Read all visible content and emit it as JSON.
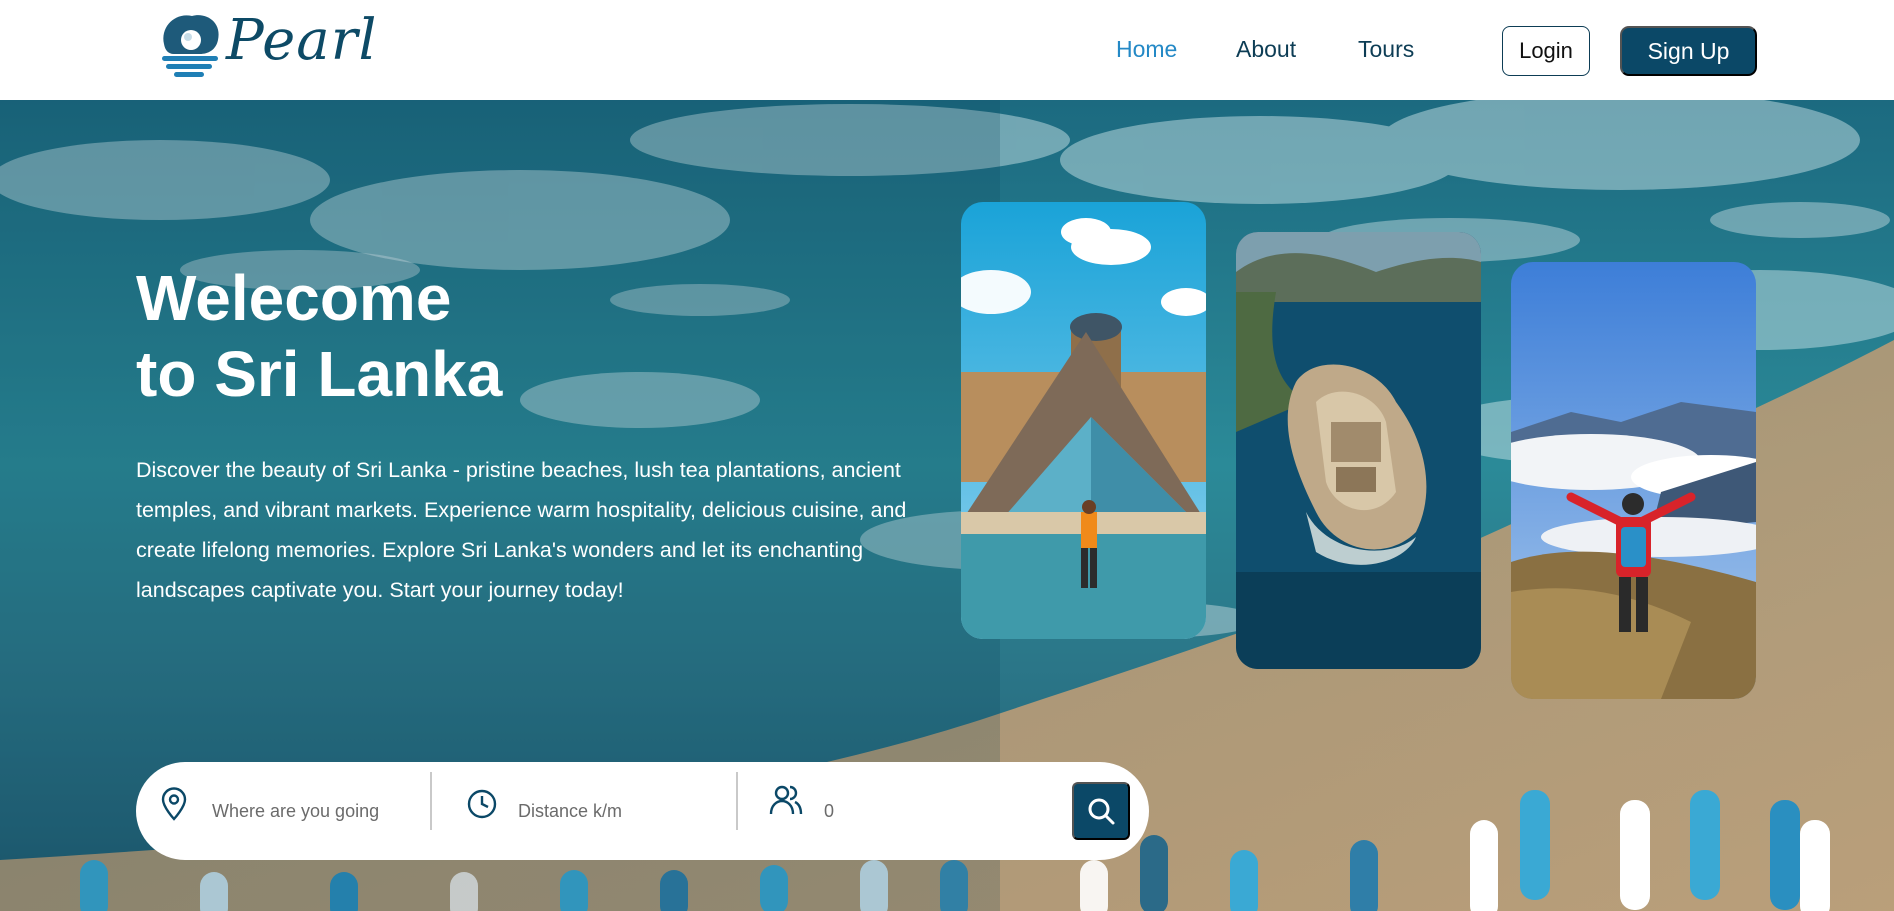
{
  "brand": {
    "name": "Pearl"
  },
  "nav": {
    "items": [
      {
        "label": "Home",
        "active": true
      },
      {
        "label": "About",
        "active": false
      },
      {
        "label": "Tours",
        "active": false
      }
    ],
    "login_label": "Login",
    "signup_label": "Sign Up"
  },
  "hero": {
    "title_line1": "Welecome",
    "title_line2": "to Sri Lanka",
    "description": "Discover the beauty of Sri Lanka - pristine beaches, lush tea plantations, ancient temples, and vibrant markets. Experience warm hospitality, delicious cuisine, and create lifelong memories. Explore Sri Lanka's wonders and let its enchanting landscapes captivate you. Start your journey today!",
    "cards": [
      {
        "icon": "louvre-pyramid-photo"
      },
      {
        "icon": "island-fortress-photo"
      },
      {
        "icon": "mountain-hiker-photo"
      }
    ]
  },
  "search": {
    "destination_placeholder": "Where are you going",
    "distance_placeholder": "Distance k/m",
    "guests_value": "0",
    "icons": [
      "location-pin-icon",
      "clock-icon",
      "users-icon",
      "search-icon"
    ]
  },
  "colors": {
    "primary": "#0b4867",
    "nav_active": "#2489c6",
    "nav_text": "#0d3d55"
  }
}
